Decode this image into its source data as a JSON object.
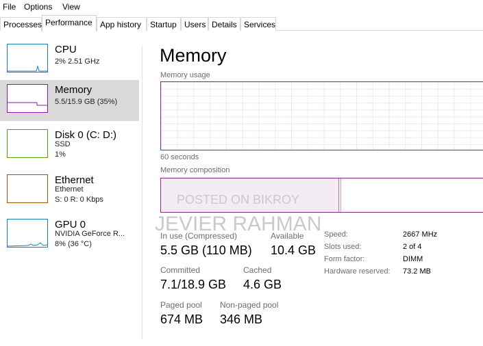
{
  "menu": [
    "File",
    "Options",
    "View"
  ],
  "tabs": [
    "Processes",
    "Performance",
    "App history",
    "Startup",
    "Users",
    "Details",
    "Services"
  ],
  "active_tab": "Performance",
  "sidebar": {
    "items": [
      {
        "title": "CPU",
        "line1": "2%  2.51 GHz",
        "line2": "",
        "color": "#117dbb",
        "selected": false
      },
      {
        "title": "Memory",
        "line1": "5.5/15.9 GB (35%)",
        "line2": "",
        "color": "#8b12ae",
        "selected": true
      },
      {
        "title": "Disk 0 (C: D:)",
        "line1": "SSD",
        "line2": "1%",
        "color": "#4da60c",
        "selected": false
      },
      {
        "title": "Ethernet",
        "line1": "Ethernet",
        "line2": "S: 0  R: 0 Kbps",
        "color": "#a74f01",
        "selected": false
      },
      {
        "title": "GPU 0",
        "line1": "NVIDIA GeForce R...",
        "line2": "8%  (36 °C)",
        "color": "#117dbb",
        "selected": false
      }
    ]
  },
  "main": {
    "title": "Memory",
    "usage_label": "Memory usage",
    "time_label": "60 seconds",
    "composition_label": "Memory composition",
    "composition_in_use_fraction": 0.55,
    "accent_color": "#8b2a8b"
  },
  "stats": {
    "in_use": {
      "label": "In use (Compressed)",
      "value": "5.5 GB (110 MB)"
    },
    "available": {
      "label": "Available",
      "value": "10.4 GB"
    },
    "committed": {
      "label": "Committed",
      "value": "7.1/18.9 GB"
    },
    "cached": {
      "label": "Cached",
      "value": "4.6 GB"
    },
    "paged_pool": {
      "label": "Paged pool",
      "value": "674 MB"
    },
    "non_paged_pool": {
      "label": "Non-paged pool",
      "value": "346 MB"
    }
  },
  "specs": [
    {
      "label": "Speed:",
      "value": "2667 MHz"
    },
    {
      "label": "Slots used:",
      "value": "2 of 4"
    },
    {
      "label": "Form factor:",
      "value": "DIMM"
    },
    {
      "label": "Hardware reserved:",
      "value": "73.2 MB"
    }
  ],
  "watermarks": [
    "POSTED ON BIKROY",
    "JEVIER RAHMAN"
  ]
}
